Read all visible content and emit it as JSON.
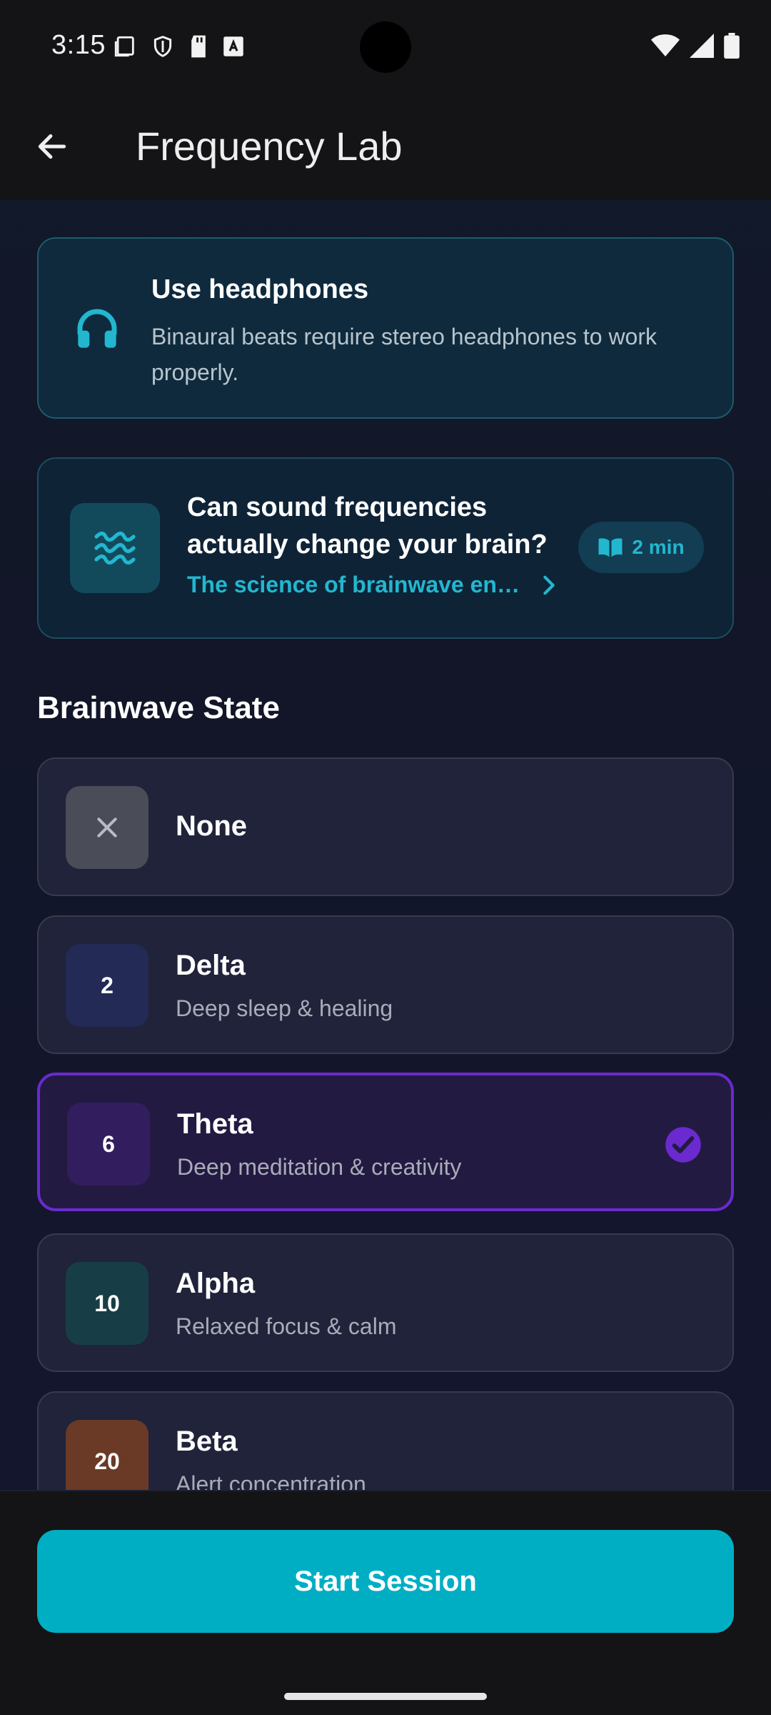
{
  "status_bar": {
    "time": "3:15"
  },
  "app_bar": {
    "title": "Frequency Lab"
  },
  "headphones_card": {
    "title": "Use headphones",
    "description": "Binaural beats require stereo headphones to work properly.",
    "icon": "headphones-icon"
  },
  "article_card": {
    "title": "Can sound frequencies actually change your brain?",
    "subtitle": "The science of brainwave en…",
    "read_time": "2 min",
    "icon": "waves-icon"
  },
  "section": {
    "title": "Brainwave State"
  },
  "states": [
    {
      "name": "None",
      "description": "",
      "badge": "",
      "badge_color": "#4a4c58",
      "selected": false
    },
    {
      "name": "Delta",
      "description": "Deep sleep & healing",
      "badge": "2",
      "badge_color": "#222a55",
      "selected": false
    },
    {
      "name": "Theta",
      "description": "Deep meditation & creativity",
      "badge": "6",
      "badge_color": "#321d5e",
      "selected": true
    },
    {
      "name": "Alpha",
      "description": "Relaxed focus & calm",
      "badge": "10",
      "badge_color": "#173e46",
      "selected": false
    },
    {
      "name": "Beta",
      "description": "Alert concentration",
      "badge": "20",
      "badge_color": "#6a3a26",
      "selected": false
    }
  ],
  "colors": {
    "accent": "#00aec4",
    "selected_border": "#6a2ad0"
  },
  "actions": {
    "start_label": "Start Session"
  }
}
